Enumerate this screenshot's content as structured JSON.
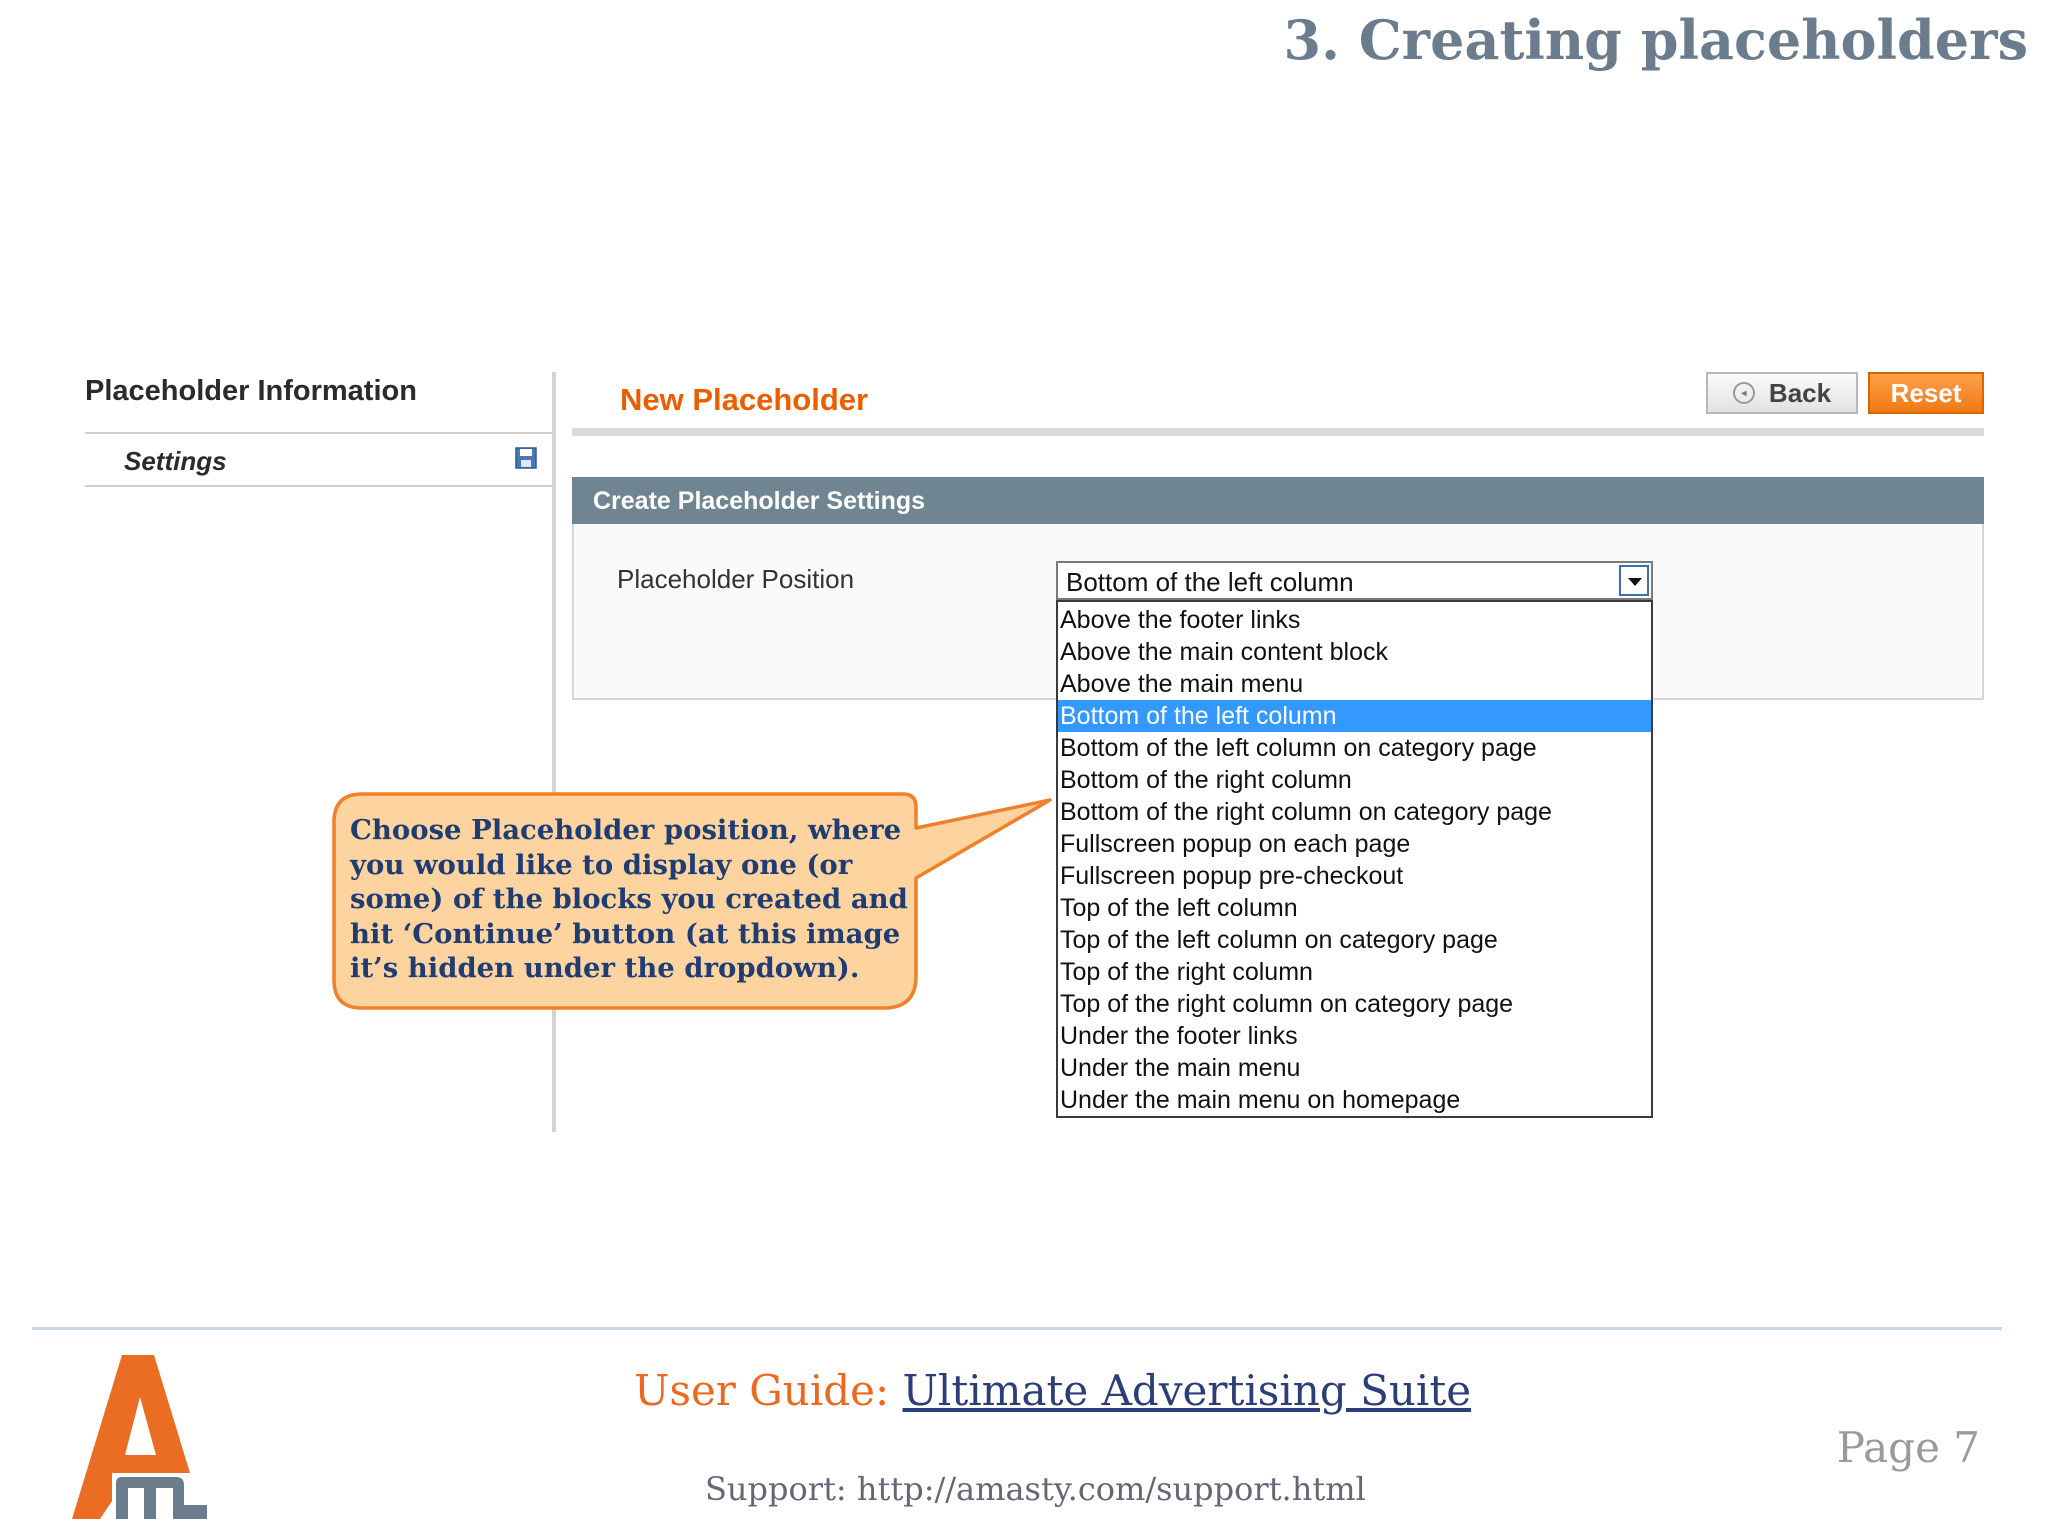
{
  "page_heading": "3. Creating placeholders",
  "sidebar": {
    "title": "Placeholder Information",
    "items": [
      {
        "label": "Settings",
        "icon": "save-icon"
      }
    ]
  },
  "header": {
    "title": "New Placeholder",
    "back_label": "Back",
    "reset_label": "Reset"
  },
  "fieldset": {
    "title": "Create Placeholder Settings",
    "field_label": "Placeholder Position",
    "selected_value": "Bottom of the left column",
    "options": [
      "Above the footer links",
      "Above the main content block",
      "Above the main menu",
      "Bottom of the left column",
      "Bottom of the left column on category page",
      "Bottom of the right column",
      "Bottom of the right column on category page",
      "Fullscreen popup on each page",
      "Fullscreen popup pre-checkout",
      "Top of the left column",
      "Top of the left column on category page",
      "Top of the right column",
      "Top of the right column on category page",
      "Under the footer links",
      "Under the main menu",
      "Under the main menu on homepage"
    ],
    "selected_index": 3
  },
  "callout": {
    "text": "Choose Placeholder position, where you would like to display one (or some) of the blocks you created and hit ‘Continue’ button (at this image it’s hidden under the dropdown)."
  },
  "footer": {
    "guide_prefix": "User Guide: ",
    "guide_link": "Ultimate Advertising Suite",
    "support": "Support: http://amasty.com/support.html",
    "page": "Page 7"
  },
  "colors": {
    "accent_orange": "#eb5e00",
    "fieldset_header": "#6f8592",
    "selection_blue": "#3399ff",
    "callout_fill": "#fdd4a0",
    "callout_border": "#f0802a"
  }
}
